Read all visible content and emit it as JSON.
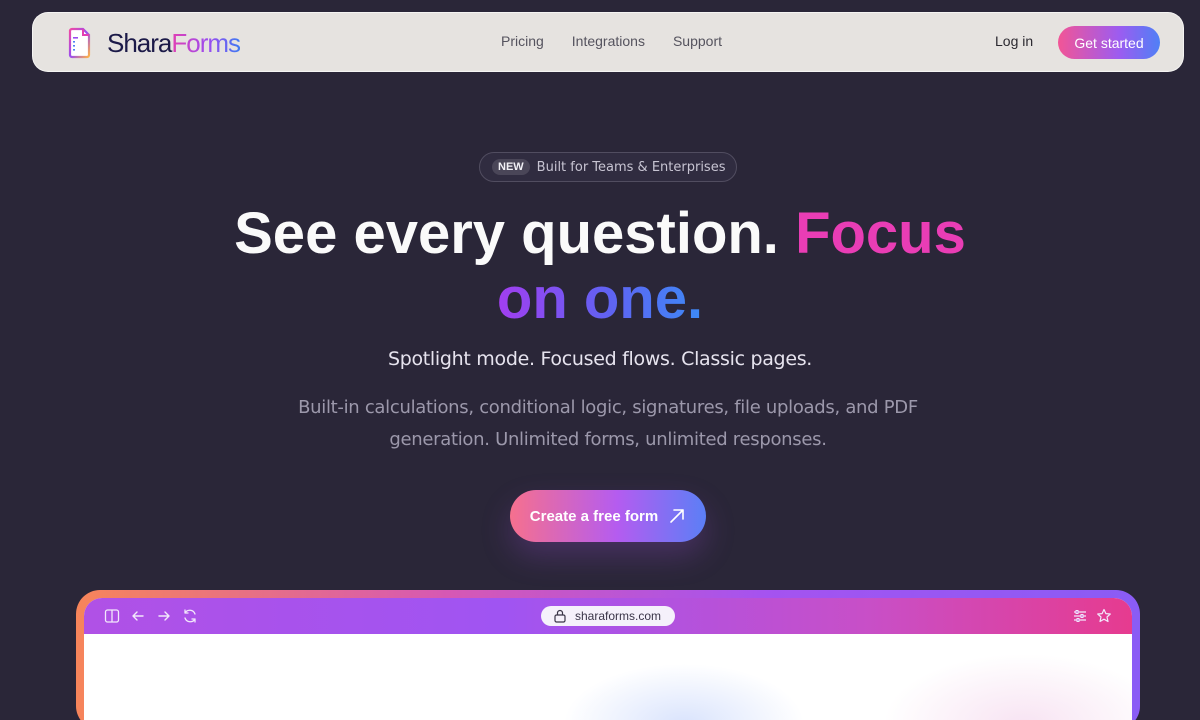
{
  "nav": {
    "brand_part1": "Shara",
    "brand_part2": "Forms",
    "links": [
      "Pricing",
      "Integrations",
      "Support"
    ],
    "login": "Log in",
    "cta": "Get started"
  },
  "hero": {
    "badge_new": "NEW",
    "badge_text": "Built for Teams & Enterprises",
    "headline_white": "See every question.",
    "headline_pink": "Focus",
    "headline_line2": "on one.",
    "subheadline": "Spotlight mode. Focused flows. Classic pages.",
    "description": "Built-in calculations, conditional logic, signatures, file uploads, and PDF generation. Unlimited forms, unlimited responses.",
    "cta": "Create a free form"
  },
  "browser": {
    "url": "sharaforms.com",
    "icons": [
      "sidebar-icon",
      "back-arrow-icon",
      "forward-arrow-icon",
      "reload-icon",
      "lock-icon",
      "settings-sliders-icon",
      "star-icon"
    ]
  },
  "colors": {
    "background": "#2a2638",
    "accent_pink": "#e93db5",
    "accent_purple": "#a23ef0",
    "accent_blue": "#3d8af6"
  }
}
